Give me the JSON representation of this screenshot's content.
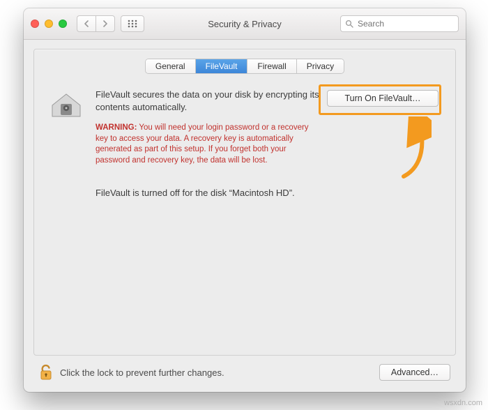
{
  "window": {
    "title": "Security & Privacy"
  },
  "search": {
    "placeholder": "Search",
    "value": ""
  },
  "tabs": {
    "general": "General",
    "filevault": "FileVault",
    "firewall": "Firewall",
    "privacy": "Privacy"
  },
  "pane": {
    "intro": "FileVault secures the data on your disk by encrypting its contents automatically.",
    "warning_label": "WARNING:",
    "warning_body": "You will need your login password or a recovery key to access your data. A recovery key is automatically generated as part of this setup. If you forget both your password and recovery key, the data will be lost.",
    "off_status": "FileVault is turned off for the disk “Macintosh HD”.",
    "turn_on_label": "Turn On FileVault…"
  },
  "footer": {
    "lock_text": "Click the lock to prevent further changes.",
    "advanced_label": "Advanced…"
  },
  "watermark": "wsxdn.com"
}
